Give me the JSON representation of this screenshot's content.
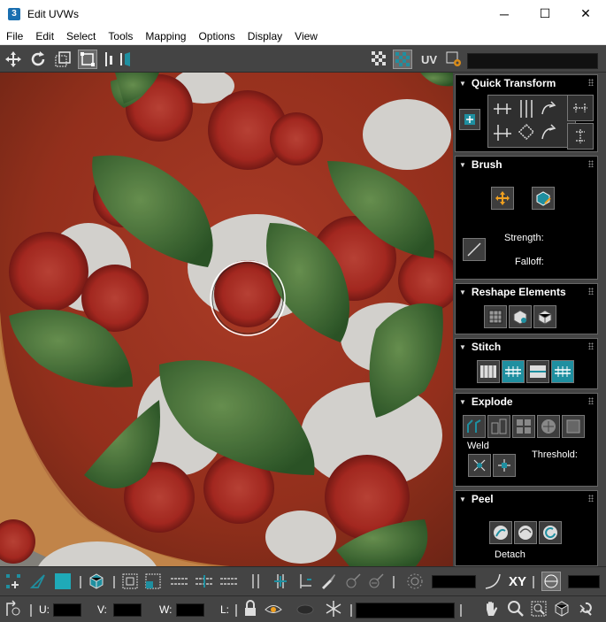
{
  "window": {
    "title": "Edit UVWs",
    "app_badge": "3",
    "minimize": "─",
    "maximize": "☐",
    "close": "✕"
  },
  "menu": [
    "File",
    "Edit",
    "Select",
    "Tools",
    "Mapping",
    "Options",
    "Display",
    "View"
  ],
  "toolbar_top": {
    "uv_label": "UV"
  },
  "rollouts": {
    "quick_transform": {
      "title": "Quick Transform"
    },
    "brush": {
      "title": "Brush",
      "strength_label": "Strength:",
      "falloff_label": "Falloff:"
    },
    "reshape": {
      "title": "Reshape Elements"
    },
    "stitch": {
      "title": "Stitch"
    },
    "explode": {
      "title": "Explode",
      "weld_label": "Weld",
      "threshold_label": "Threshold:"
    },
    "peel": {
      "title": "Peel",
      "detach_label": "Detach"
    }
  },
  "bottom_toolbar": {
    "xy_label": "XY"
  },
  "status_bar": {
    "u_label": "U:",
    "v_label": "V:",
    "w_label": "W:",
    "l_label": "L:",
    "u_value": "",
    "v_value": "",
    "w_value": ""
  },
  "colors": {
    "accent_teal": "#1f8fa0",
    "panel_bg": "#000000",
    "toolbar_bg": "#444444"
  }
}
